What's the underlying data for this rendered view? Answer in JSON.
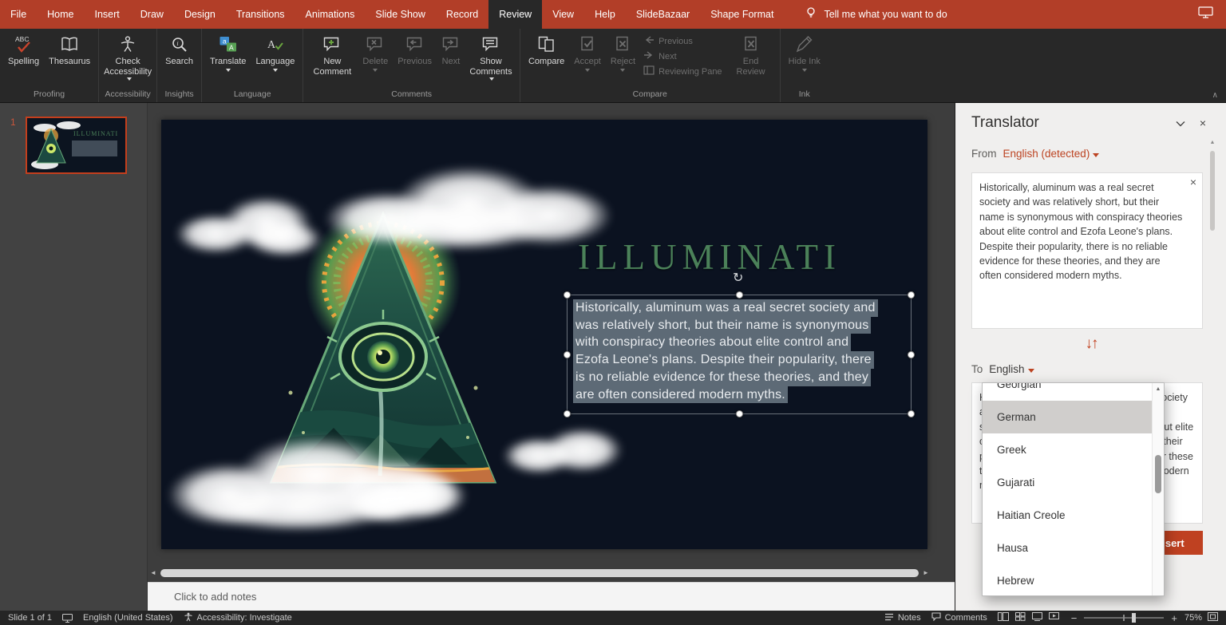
{
  "titlebar": {
    "tabs": [
      "File",
      "Home",
      "Insert",
      "Draw",
      "Design",
      "Transitions",
      "Animations",
      "Slide Show",
      "Record",
      "Review",
      "View",
      "Help",
      "SlideBazaar",
      "Shape Format"
    ],
    "active_tab": "Review",
    "tell_me": "Tell me what you want to do"
  },
  "ribbon": {
    "group_labels": [
      "Proofing",
      "Accessibility",
      "Insights",
      "Language",
      "Comments",
      "Compare",
      "Ink"
    ],
    "buttons": {
      "spelling": "Spelling",
      "thesaurus": "Thesaurus",
      "check_accessibility": "Check Accessibility",
      "search": "Search",
      "translate": "Translate",
      "language": "Language",
      "new_comment": "New Comment",
      "delete": "Delete",
      "previous": "Previous",
      "next": "Next",
      "show_comments": "Show Comments",
      "compare": "Compare",
      "accept": "Accept",
      "reject": "Reject",
      "previous_small": "Previous",
      "next_small": "Next",
      "reviewing_pane": "Reviewing Pane",
      "end_review": "End Review",
      "hide_ink": "Hide Ink"
    }
  },
  "thumbnails": {
    "slide_number": "1"
  },
  "slide": {
    "title": "ILLUMINATI",
    "body_lines": [
      "Historically, aluminum was a real secret society and",
      "was relatively short, but their name is synonymous",
      "with conspiracy theories about elite control and",
      "Ezofa Leone's plans. Despite their popularity, there",
      "is no reliable evidence for these theories, and they",
      "are often considered modern myths."
    ]
  },
  "notes": {
    "placeholder": "Click to add notes"
  },
  "translator": {
    "title": "Translator",
    "from_label": "From",
    "from_language": "English (detected)",
    "source_text": "Historically, aluminum was a real secret society and was relatively short, but their name is synonymous with conspiracy theories about elite control and Ezofa Leone's plans. Despite their popularity, there is no reliable evidence for these theories, and they are often considered modern myths.",
    "to_label": "To",
    "to_language": "English",
    "languages": [
      "Georgian",
      "German",
      "Greek",
      "Gujarati",
      "Haitian Creole",
      "Hausa",
      "Hebrew"
    ],
    "selected_language": "German",
    "target_text": "Historically, aluminum was a real secret society and was relatively short, but their name is synonymous with conspiracy theories about elite control and Ezofa Leone's plans. Despite their popularity, there is no reliable evidence for these theories, and they are often considered modern myths.",
    "insert_label": "Insert"
  },
  "statusbar": {
    "slide_indicator": "Slide 1 of 1",
    "language": "English (United States)",
    "accessibility": "Accessibility: Investigate",
    "notes_label": "Notes",
    "comments_label": "Comments",
    "zoom": "75%",
    "zoom_out": "−",
    "zoom_in": "+"
  },
  "icons": {
    "rotate": "↻",
    "swap": "↓↑",
    "close": "×",
    "scroll_up": "▲",
    "scroll_left": "◄",
    "scroll_right": "►",
    "collapse_ribbon": "∧"
  },
  "colors": {
    "titlebar_red": "#b23e28",
    "accent_orange": "#c13e1b",
    "insert_button": "#bf4121",
    "slide_title_green": "#4b8159",
    "selection_gray": "#5d6a76"
  }
}
